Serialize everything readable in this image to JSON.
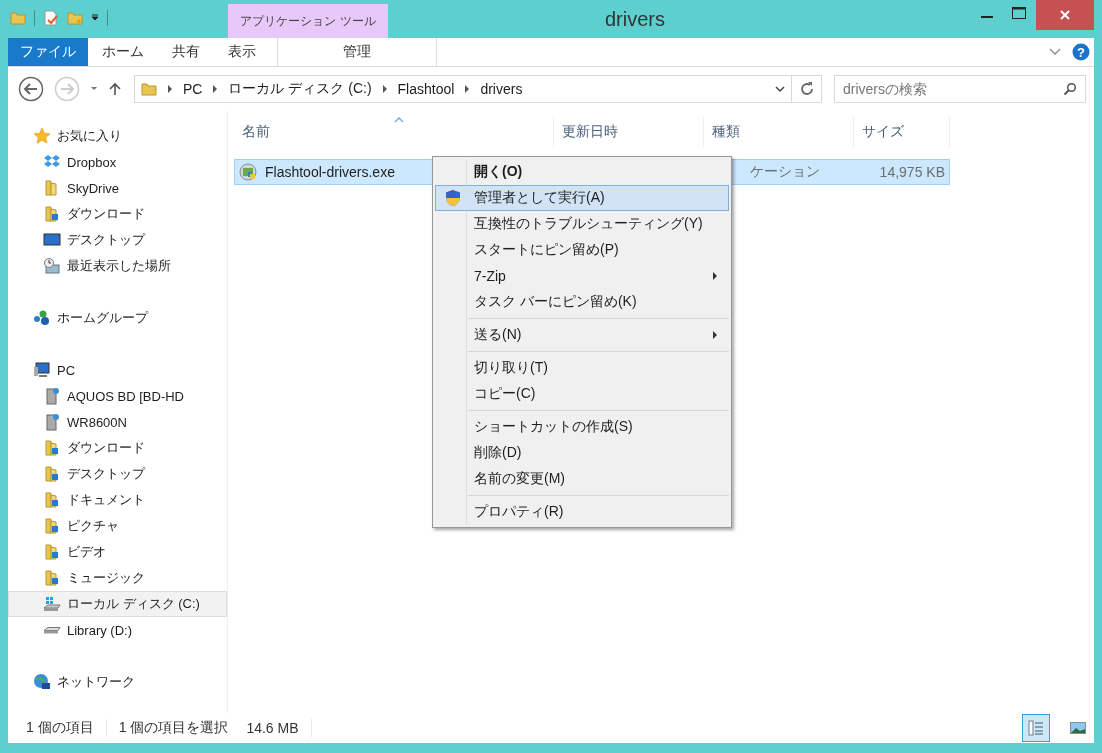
{
  "window": {
    "title": "drivers"
  },
  "ribbon": {
    "contextual_group": "アプリケーション ツール",
    "help": "?",
    "tabs": [
      {
        "label": "ファイル",
        "kind": "file"
      },
      {
        "label": "ホーム",
        "kind": "normal"
      },
      {
        "label": "共有",
        "kind": "normal"
      },
      {
        "label": "表示",
        "kind": "normal"
      },
      {
        "label": "管理",
        "kind": "contextual"
      }
    ]
  },
  "address": {
    "breadcrumbs": [
      "PC",
      "ローカル ディスク (C:)",
      "Flashtool",
      "drivers"
    ]
  },
  "search": {
    "placeholder": "driversの検索"
  },
  "sidebar": {
    "groups": [
      {
        "label": "お気に入り",
        "selected": false,
        "children": [
          {
            "label": "Dropbox",
            "selected": false
          },
          {
            "label": "SkyDrive",
            "selected": false
          },
          {
            "label": "ダウンロード",
            "selected": false
          },
          {
            "label": "デスクトップ",
            "selected": false
          },
          {
            "label": "最近表示した場所",
            "selected": false
          }
        ]
      },
      {
        "label": "ホームグループ",
        "selected": false
      },
      {
        "label": "PC",
        "selected": false,
        "children": [
          {
            "label": "AQUOS BD [BD-HD",
            "selected": false
          },
          {
            "label": "WR8600N",
            "selected": false
          },
          {
            "label": "ダウンロード",
            "selected": false
          },
          {
            "label": "デスクトップ",
            "selected": false
          },
          {
            "label": "ドキュメント",
            "selected": false
          },
          {
            "label": "ピクチャ",
            "selected": false
          },
          {
            "label": "ビデオ",
            "selected": false
          },
          {
            "label": "ミュージック",
            "selected": false
          },
          {
            "label": "ローカル ディスク (C:)",
            "selected": true
          },
          {
            "label": "Library (D:)",
            "selected": false
          }
        ]
      },
      {
        "label": "ネットワーク",
        "selected": false
      }
    ]
  },
  "file_list": {
    "columns": [
      {
        "label": "名前",
        "sorted": true
      },
      {
        "label": "更新日時",
        "sorted": false
      },
      {
        "label": "種類",
        "sorted": false
      },
      {
        "label": "サイズ",
        "sorted": false
      }
    ],
    "rows": [
      {
        "name": "Flashtool-drivers.exe",
        "type": "ケーション",
        "size": "14,975 KB",
        "selected": true
      }
    ]
  },
  "context_menu": {
    "groups": [
      [
        {
          "label": "開く(O)",
          "default": true,
          "shield": false,
          "submenu": false,
          "selected": false
        },
        {
          "label": "管理者として実行(A)",
          "default": false,
          "shield": true,
          "submenu": false,
          "selected": true
        },
        {
          "label": "互換性のトラブルシューティング(Y)",
          "default": false,
          "shield": false,
          "submenu": false,
          "selected": false
        },
        {
          "label": "スタートにピン留め(P)",
          "default": false,
          "shield": false,
          "submenu": false,
          "selected": false
        },
        {
          "label": "7-Zip",
          "default": false,
          "shield": false,
          "submenu": true,
          "selected": false
        },
        {
          "label": "タスク バーにピン留め(K)",
          "default": false,
          "shield": false,
          "submenu": false,
          "selected": false
        }
      ],
      [
        {
          "label": "送る(N)",
          "default": false,
          "shield": false,
          "submenu": true,
          "selected": false
        }
      ],
      [
        {
          "label": "切り取り(T)",
          "default": false,
          "shield": false,
          "submenu": false,
          "selected": false
        },
        {
          "label": "コピー(C)",
          "default": false,
          "shield": false,
          "submenu": false,
          "selected": false
        }
      ],
      [
        {
          "label": "ショートカットの作成(S)",
          "default": false,
          "shield": false,
          "submenu": false,
          "selected": false
        },
        {
          "label": "削除(D)",
          "default": false,
          "shield": false,
          "submenu": false,
          "selected": false
        },
        {
          "label": "名前の変更(M)",
          "default": false,
          "shield": false,
          "submenu": false,
          "selected": false
        }
      ],
      [
        {
          "label": "プロパティ(R)",
          "default": false,
          "shield": false,
          "submenu": false,
          "selected": false
        }
      ]
    ]
  },
  "status_bar": {
    "item_count": "1 個の項目",
    "selection": "1 個の項目を選択",
    "selection_size": "14.6 MB"
  },
  "view_buttons": [
    {
      "kind": "details",
      "selected": true
    },
    {
      "kind": "large-icons",
      "selected": false
    }
  ]
}
